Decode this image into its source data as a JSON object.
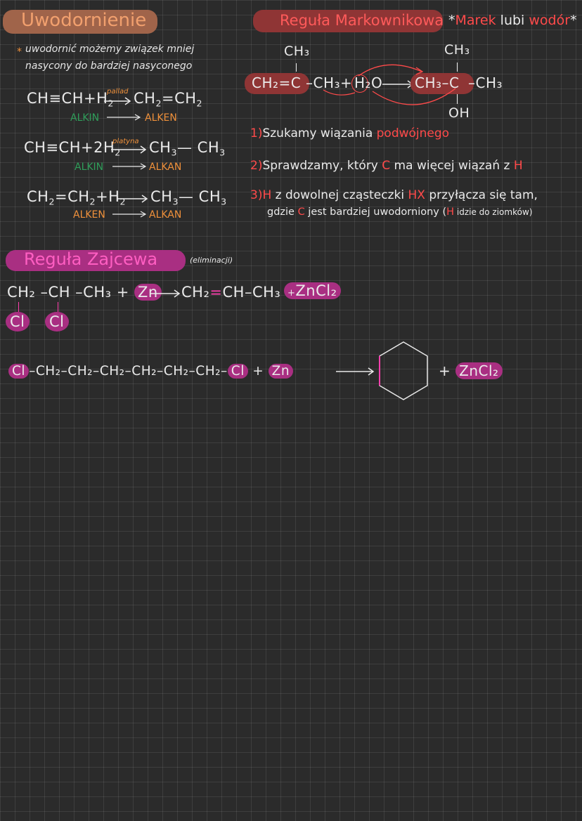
{
  "uwod": {
    "title": "Uwodornienie",
    "note": "uwodornić możemy związek mniej nasycony do bardziej nasyconego",
    "eq1": {
      "lhs": "CH≡CH+H",
      "cat": "pallad",
      "rhs": "CH",
      "rhs2": "=CH",
      "l1": "ALKIN",
      "l2": "ALKEN"
    },
    "eq2": {
      "lhs": "CH≡CH+2H",
      "cat": "platyna",
      "rhs": "CH",
      "rhs2": "— CH",
      "l1": "ALKIN",
      "l2": "ALKAN"
    },
    "eq3": {
      "lhs": "CH",
      "lhs2": "=CH",
      "lhs3": "+H",
      "rhs": "CH",
      "rhs2": "— CH",
      "l1": "ALKEN",
      "l2": "ALKAN"
    },
    "sub2": "2",
    "sub3": "3"
  },
  "mark": {
    "title": "Reguła Markownikowa",
    "star": "*",
    "mnemo1": "Marek",
    "mnemo2": "lubi",
    "mnemo3": "wodór",
    "star2": "*",
    "ch3": "CH₃",
    "oh": "OH",
    "reactant": "CH₂=C",
    "reactant_tail": "–CH₃+",
    "water": "H₂O",
    "product_a": "CH₃–C",
    "product_b": "–CH₃",
    "items": [
      {
        "num": "1)",
        "text": "Szukamy wiązania ",
        "accent": "podwójnego"
      },
      {
        "num": "2)",
        "text": "Sprawdzamy, który ",
        "accent": "C",
        "text2": " ma więcej wiązań z ",
        "accent2": "H"
      },
      {
        "num": "3)",
        "accent": "H",
        "text": " z dowolnej cząsteczki ",
        "accent2": "HX",
        "text2": " przyłącza się tam,",
        "line2": "gdzie ",
        "accent3": "C",
        "line2b": " jest bardziej uwodorniony (",
        "accent4": "H",
        "line2c": " idzie do ziomków)"
      }
    ]
  },
  "zaj": {
    "title": "Reguła Zajcewa",
    "paren": "(eliminacji)",
    "eq_lhs": "CH₂ –CH –CH₃ +",
    "zn": "Zn",
    "eq_mid": "CH₂",
    "dbl": "=",
    "eq_mid2": "CH–CH₃",
    "plus": "+",
    "zncl": "ZnCl₂",
    "cl1": "Cl",
    "cl2": "Cl",
    "chain_cl1": "Cl",
    "chain_mid": "–CH₂–CH₂–CH₂–CH₂–CH₂–CH₂–",
    "chain_cl2": "Cl",
    "chain_plus": "+",
    "chain_zn": "Zn",
    "chain_plus2": "+",
    "chain_zncl": "ZnCl₂",
    "arrow": "⟶"
  },
  "colors": {
    "orange": "#f0913b",
    "red": "#ff4a4a",
    "pink": "#ff3fae",
    "highlight_brown": "#b5714e",
    "highlight_red": "#8f3535",
    "highlight_magenta": "#a92f82"
  }
}
